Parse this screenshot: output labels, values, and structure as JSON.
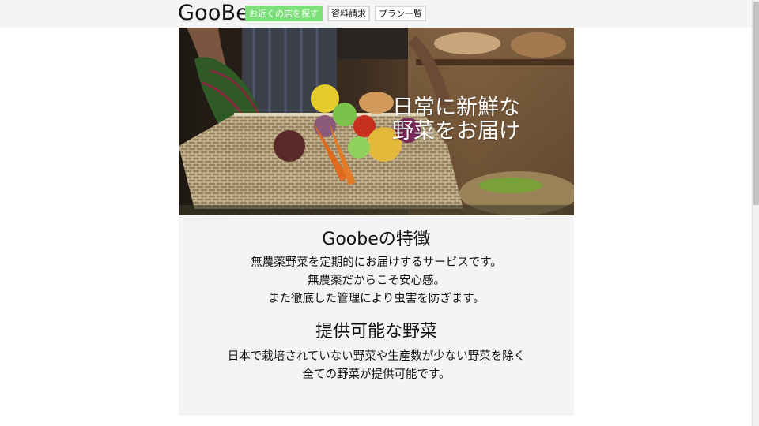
{
  "header": {
    "logo": "GooBe",
    "nav": [
      {
        "label": "お近くの店を探す",
        "active": true
      },
      {
        "label": "資料請求",
        "active": false
      },
      {
        "label": "プラン一覧",
        "active": false
      }
    ]
  },
  "hero": {
    "title_line1": "日常に新鮮な",
    "title_line2": "野菜をお届け"
  },
  "features": {
    "heading": "Goobeの特徴",
    "lines": [
      "無農薬野菜を定期的にお届けするサービスです。",
      "無農薬だからこそ安心感。",
      "また徹底した管理により虫害を防ぎます。"
    ]
  },
  "vegetables": {
    "heading": "提供可能な野菜",
    "lines": [
      "日本で栽培されていない野菜や生産数が少ない野菜を除く",
      "全ての野菜が提供可能です。"
    ]
  },
  "colors": {
    "accent_nav": "#7ee07a",
    "section_bg": "#f4f4f4"
  }
}
